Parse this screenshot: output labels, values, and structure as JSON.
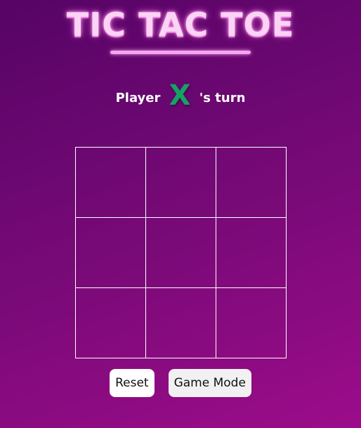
{
  "header": {
    "title": "TIC TAC TOE"
  },
  "status": {
    "prefix": "Player",
    "current_player": "X",
    "suffix": "'s turn",
    "player_color": "#14a266"
  },
  "board": {
    "cells": [
      "",
      "",
      "",
      "",
      "",
      "",
      "",
      "",
      ""
    ]
  },
  "controls": {
    "reset_label": "Reset",
    "mode_label": "Game Mode"
  },
  "colors": {
    "background_start": "#560466",
    "background_end": "#9c0c8a",
    "title": "#fbd3f5",
    "grid_lines": "#ffffff"
  }
}
